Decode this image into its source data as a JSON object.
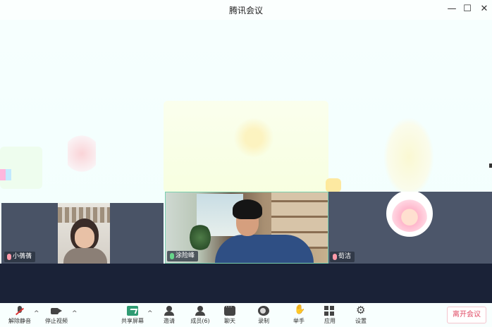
{
  "window": {
    "title": "腾讯会议",
    "minimize": "—",
    "maximize": "☐",
    "close": "✕"
  },
  "participants": [
    {
      "name": "小蒨蒨",
      "mic": "muted"
    },
    {
      "name": "涂险峰",
      "mic": "speaking"
    },
    {
      "name": "荀洁",
      "mic": "muted"
    }
  ],
  "toolbar": {
    "unmute": "解除静音",
    "stop_video": "停止视频",
    "share_screen": "共享屏幕",
    "invite": "邀请",
    "members": "成员(6)",
    "chat": "聊天",
    "record": "录制",
    "raise_hand": "举手",
    "apps": "应用",
    "settings": "设置",
    "caret": "^",
    "leave": "离开会议"
  },
  "colors": {
    "accent": "#2f9b73",
    "leave": "#e04a64",
    "band": "#1a2237"
  }
}
